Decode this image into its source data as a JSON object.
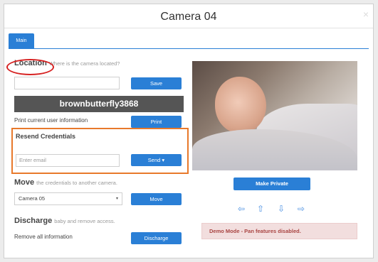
{
  "dialog": {
    "title": "Camera 04",
    "close_glyph": "×"
  },
  "tabs": [
    {
      "label": "Main",
      "active": true
    }
  ],
  "location": {
    "title": "Location",
    "hint": "Where is the camera located?",
    "input_value": "",
    "save_label": "Save"
  },
  "username": "brownbutterfly3868",
  "print": {
    "label": "Print current user information",
    "button": "Print"
  },
  "resend": {
    "title": "Resend Credentials",
    "email_placeholder": "Enter email",
    "send_label": "Send",
    "send_caret": "▾"
  },
  "move": {
    "title": "Move",
    "hint": "the credentials to another camera.",
    "selected_camera": "Camera 05",
    "select_caret": "▾",
    "button": "Move"
  },
  "discharge": {
    "title": "Discharge",
    "hint": "baby and remove access.",
    "label": "Remove all information",
    "button": "Discharge"
  },
  "camera": {
    "make_private_label": "Make Private",
    "pan_icons": {
      "left": "⇦",
      "up": "⇧",
      "down": "⇩",
      "right": "⇨"
    },
    "alert": "Demo Mode - Pan features disabled."
  },
  "colors": {
    "accent": "#2a7fd6",
    "highlight_orange": "#e8792b",
    "highlight_red": "#d62222",
    "alert_bg": "#f2dede",
    "alert_text": "#a94442"
  }
}
